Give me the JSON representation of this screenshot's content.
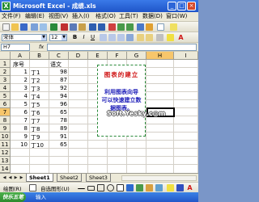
{
  "window": {
    "title": "Microsoft Excel - 成绩.xls"
  },
  "menu": [
    "文件(F)",
    "编辑(E)",
    "视图(V)",
    "插入(I)",
    "格式(O)",
    "工具(T)",
    "数据(D)",
    "窗口(W)"
  ],
  "toolbar": {
    "font_name": "宋体",
    "font_size": "12"
  },
  "formula_bar": {
    "name_box": "H7",
    "fx": "fx",
    "content": ""
  },
  "columns": [
    "A",
    "B",
    "C",
    "D",
    "E",
    "F",
    "G",
    "H",
    "I"
  ],
  "rows": [
    "1",
    "2",
    "3",
    "4",
    "5",
    "6",
    "7",
    "8",
    "9",
    "10",
    "11",
    "12",
    "13",
    "14"
  ],
  "table": {
    "header_a": "序号",
    "header_c": "语文",
    "data": [
      {
        "no": "1",
        "name": "丁1",
        "score": "98"
      },
      {
        "no": "2",
        "name": "丁2",
        "score": "87"
      },
      {
        "no": "3",
        "name": "丁3",
        "score": "92"
      },
      {
        "no": "4",
        "name": "丁4",
        "score": "94"
      },
      {
        "no": "5",
        "name": "丁5",
        "score": "96"
      },
      {
        "no": "6",
        "name": "丁6",
        "score": "65"
      },
      {
        "no": "7",
        "name": "丁7",
        "score": "78"
      },
      {
        "no": "8",
        "name": "丁8",
        "score": "89"
      },
      {
        "no": "9",
        "name": "丁9",
        "score": "91"
      },
      {
        "no": "10",
        "name": "丁10",
        "score": "65"
      }
    ]
  },
  "textbox": {
    "title": "图表的建立",
    "line1": "利用图表向导",
    "line2": "可以快速建立数",
    "line3": "据图表。"
  },
  "watermark": "Soft.Yesky.c◎m",
  "sheets": [
    "Sheet1",
    "Sheet2",
    "Sheet3"
  ],
  "draw_toolbar": {
    "draw_label": "绘图(R)",
    "autoshape_label": "自选图形(U)"
  },
  "taskbar": {
    "start_label": "快乐五笔",
    "item": "输入"
  }
}
